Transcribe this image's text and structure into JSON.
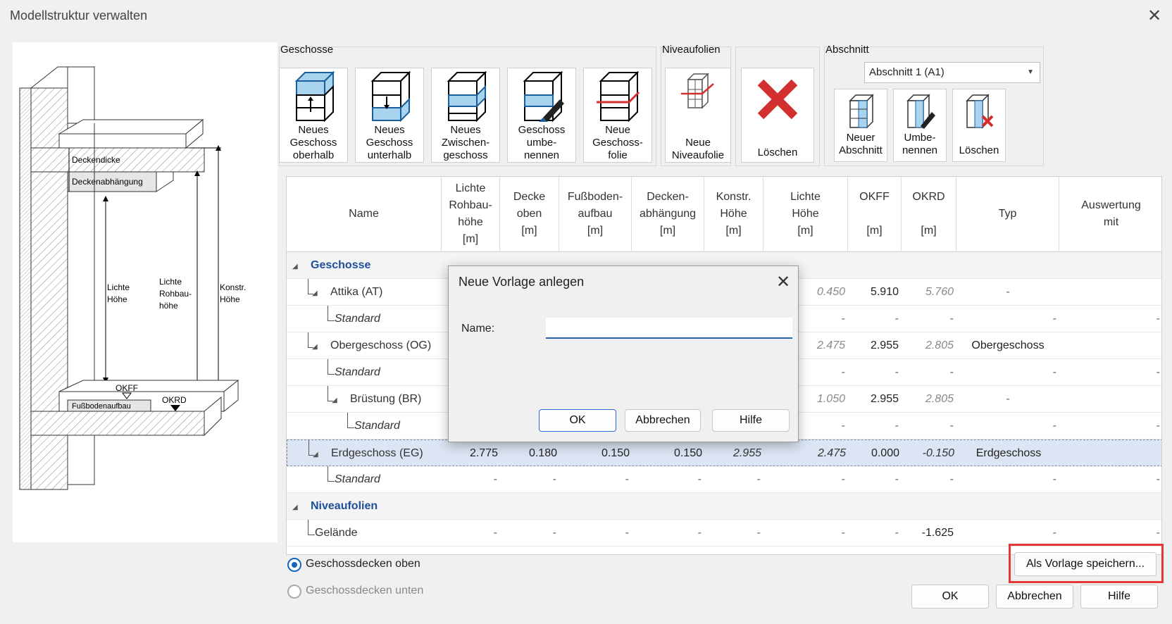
{
  "window": {
    "title": "Modellstruktur verwalten"
  },
  "diagram": {
    "labels": {
      "deckendicke": "Deckendicke",
      "deckenabhaengung": "Deckenabhängung",
      "lichte_hoehe_1": "Lichte",
      "lichte_hoehe_2": "Höhe",
      "rohbau_1": "Lichte",
      "rohbau_2": "Rohbau-",
      "rohbau_3": "höhe",
      "konstr_1": "Konstr.",
      "konstr_2": "Höhe",
      "okff": "OKFF",
      "fussboden": "Fußbodenaufbau",
      "okrd": "OKRD"
    }
  },
  "ribbon": {
    "geschosse": {
      "label": "Geschosse",
      "buttons": [
        {
          "label": "Neues\nGeschoss\noberhalb",
          "icon": "floor-add-above-icon"
        },
        {
          "label": "Neues\nGeschoss\nunterhalb",
          "icon": "floor-add-below-icon"
        },
        {
          "label": "Neues\nZwischen-\ngeschoss",
          "icon": "floor-add-intermediate-icon"
        },
        {
          "label": "Geschoss\numbe-\nnennen",
          "icon": "floor-rename-icon"
        },
        {
          "label": "Neue\nGeschoss-\nfolie",
          "icon": "floor-layer-icon"
        }
      ]
    },
    "niveaufolien": {
      "label": "Niveaufolien",
      "button": "Neue\nNiveaufolie"
    },
    "loeschen": {
      "button": "Löschen"
    },
    "abschnitt": {
      "label": "Abschnitt",
      "select_value": "Abschnitt 1 (A1)",
      "buttons": [
        {
          "label": "Neuer\nAbschnitt",
          "icon": "section-add-icon"
        },
        {
          "label": "Umbe-\nnennen",
          "icon": "section-rename-icon"
        },
        {
          "label": "Löschen",
          "icon": "section-delete-icon"
        }
      ]
    }
  },
  "table": {
    "headers": [
      "Name",
      "Lichte\nRohbau-\nhöhe\n[m]",
      "Decke\noben\n[m]",
      "Fußboden-\naufbau\n[m]",
      "Decken-\nabhängung\n[m]",
      "Konstr.\nHöhe\n[m]",
      "Lichte\nHöhe\n[m]",
      "OKFF\n\n[m]",
      "OKRD\n\n[m]",
      "Typ",
      "Auswertung\nmit"
    ],
    "sections": {
      "geschosse": "Geschosse",
      "niveaufolien": "Niveaufolien"
    },
    "rows": [
      {
        "name": "Attika (AT)",
        "lh": "0.450",
        "okff": "5.910",
        "okrd": "5.760",
        "typ": "-",
        "ausw": ""
      },
      {
        "name": "Standard",
        "lh": "-",
        "okff": "-",
        "okrd": "-",
        "typ": "-",
        "ausw": "-"
      },
      {
        "name": "Obergeschoss (OG)",
        "lh": "2.475",
        "okff": "2.955",
        "okrd": "2.805",
        "typ": "Obergeschoss",
        "ausw": ""
      },
      {
        "name": "Standard",
        "lh": "-",
        "okff": "-",
        "okrd": "-",
        "typ": "-",
        "ausw": "-"
      },
      {
        "name": "Brüstung (BR)",
        "lh": "1.050",
        "okff": "2.955",
        "okrd": "2.805",
        "typ": "-",
        "ausw": ""
      },
      {
        "name": "Standard",
        "lh": "-",
        "okff": "-",
        "okrd": "-",
        "typ": "-",
        "ausw": "-"
      },
      {
        "name": "Erdgeschoss (EG)",
        "rb": "2.775",
        "do": "0.180",
        "fb": "0.150",
        "da": "0.150",
        "kh": "2.955",
        "lh": "2.475",
        "okff": "0.000",
        "okrd": "-0.150",
        "typ": "Erdgeschoss",
        "ausw": ""
      },
      {
        "name": "Standard",
        "rb": "-",
        "do": "-",
        "fb": "-",
        "da": "-",
        "kh": "-",
        "lh": "-",
        "okff": "-",
        "okrd": "-",
        "typ": "-",
        "ausw": "-"
      },
      {
        "name": "Gelände",
        "rb": "-",
        "do": "-",
        "fb": "-",
        "da": "-",
        "kh": "-",
        "lh": "-",
        "okff": "-",
        "okrd": "-1.625",
        "typ": "-",
        "ausw": "-"
      }
    ]
  },
  "options": {
    "oben": "Geschossdecken oben",
    "unten": "Geschossdecken unten",
    "selected": "oben"
  },
  "buttons": {
    "als_vorlage": "Als Vorlage speichern...",
    "ok": "OK",
    "abbrechen": "Abbrechen",
    "hilfe": "Hilfe"
  },
  "modal": {
    "title": "Neue Vorlage anlegen",
    "name_label": "Name:",
    "name_value": "",
    "ok": "OK",
    "abbrechen": "Abbrechen",
    "hilfe": "Hilfe"
  }
}
